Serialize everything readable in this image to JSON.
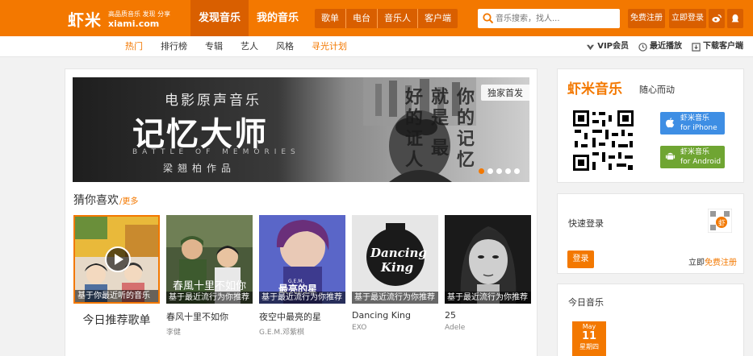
{
  "header": {
    "logo": {
      "name": "虾米",
      "slogan": "高品质音乐 发现 分享",
      "domain": "xiami.com"
    },
    "main_nav": [
      {
        "label": "发现音乐",
        "active": true
      },
      {
        "label": "我的音乐",
        "active": false
      }
    ],
    "sub_nav": [
      "歌单",
      "电台",
      "音乐人",
      "客户端"
    ],
    "search": {
      "placeholder": "音乐搜索，找人..."
    },
    "register": "免费注册",
    "login": "立即登录",
    "colors": {
      "accent": "#f37800",
      "dark_accent": "#d95f00"
    }
  },
  "secnav": {
    "left": [
      {
        "label": "热门",
        "style": "active"
      },
      {
        "label": "排行榜",
        "style": "normal"
      },
      {
        "label": "专辑",
        "style": "normal"
      },
      {
        "label": "艺人",
        "style": "normal"
      },
      {
        "label": "风格",
        "style": "normal"
      },
      {
        "label": "寻光计划",
        "style": "highlight"
      }
    ],
    "right": [
      {
        "label": "VIP会员",
        "icon": "vip-icon"
      },
      {
        "label": "最近播放",
        "icon": "clock-icon"
      },
      {
        "label": "下载客户端",
        "icon": "download-icon"
      }
    ]
  },
  "banner": {
    "line1": "电影原声音乐",
    "line2": "记忆大师",
    "line3": "BATTLE OF MEMORIES",
    "line4": "梁翘柏作品",
    "side_text": "你的记忆 就是 最好的证人",
    "badge": "独家首发",
    "dot_count": 5,
    "active_dot": 0
  },
  "recommend": {
    "title": "猜你喜欢",
    "more": "/更多",
    "cards": [
      {
        "caption": "基于你最近听的音乐",
        "big_label": "今日推荐歌单",
        "title": "",
        "artist": "",
        "type": "daily"
      },
      {
        "caption": "基于最近流行为你推荐",
        "title": "春风十里不如你",
        "artist": "李健",
        "type": "song"
      },
      {
        "caption": "基于最近流行为你推荐",
        "title": "夜空中最亮的星",
        "artist": "G.E.M.邓紫棋",
        "type": "song"
      },
      {
        "caption": "基于最近流行为你推荐",
        "title": "Dancing King",
        "artist": "EXO",
        "type": "song"
      },
      {
        "caption": "基于最近流行为你推荐",
        "title": "25",
        "artist": "Adele",
        "type": "song"
      }
    ]
  },
  "sidebar": {
    "app": {
      "brand": "虾米音乐",
      "slogan": "随心而动",
      "ios_line1": "虾米音乐",
      "ios_line2": "for iPhone",
      "android_line1": "虾米音乐",
      "android_line2": "for Android"
    },
    "quick_login": {
      "label": "快速登录",
      "login_button": "登录",
      "register_prefix": "立即",
      "register_link": "免费注册"
    },
    "today": {
      "label": "今日音乐",
      "month": "May",
      "day": "11",
      "weekday": "星期四"
    }
  }
}
